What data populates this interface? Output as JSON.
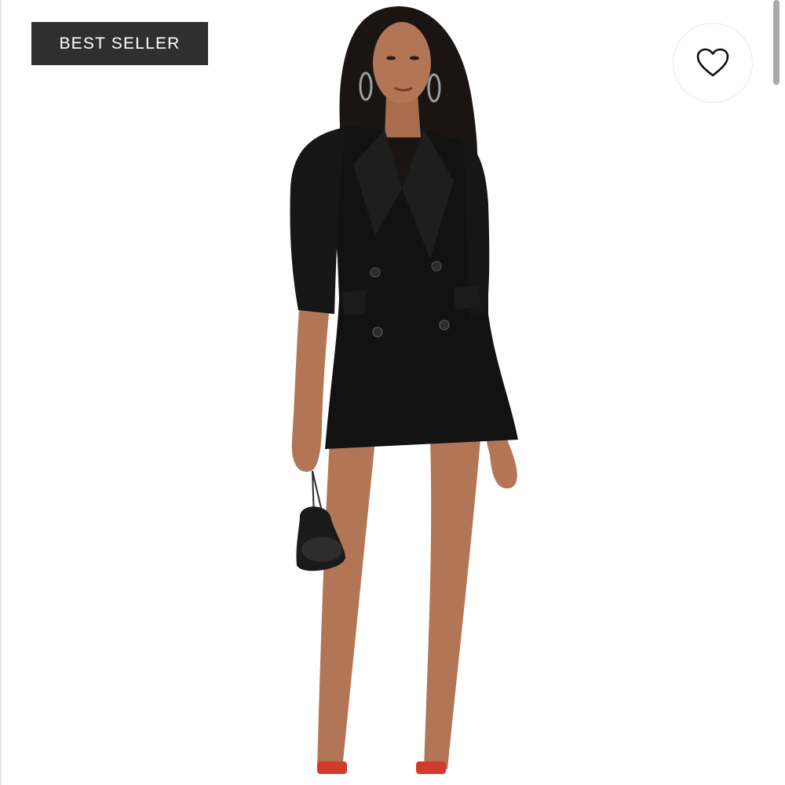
{
  "badge": {
    "label": "BEST SELLER"
  },
  "favorite": {
    "icon": "heart-outline-icon"
  },
  "product_image": {
    "description_icon": "product-photo"
  },
  "colors": {
    "badge_bg": "#2f2f2f",
    "badge_text": "#ffffff",
    "garment": "#121212",
    "skin": "#b27656",
    "shoe_straps": "#d23b2b"
  }
}
